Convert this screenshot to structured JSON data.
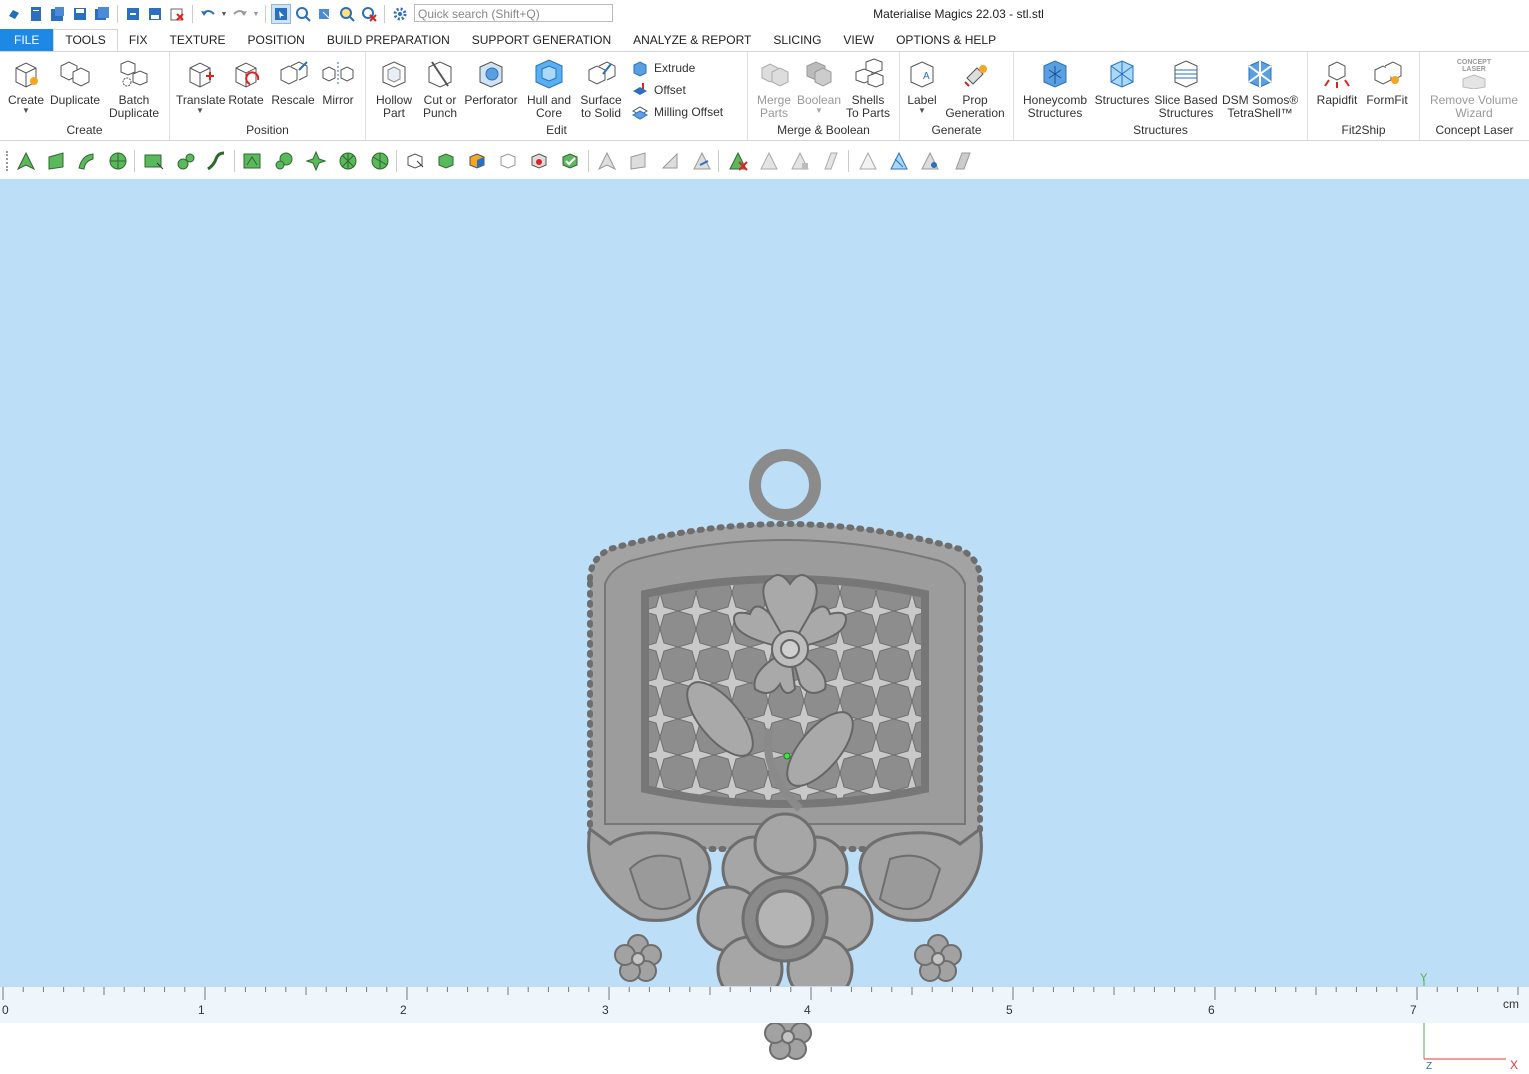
{
  "app": {
    "title": "Materialise Magics 22.03 - stl.stl",
    "search_placeholder": "Quick search (Shift+Q)"
  },
  "menu_tabs": [
    "FILE",
    "TOOLS",
    "FIX",
    "TEXTURE",
    "POSITION",
    "BUILD PREPARATION",
    "SUPPORT GENERATION",
    "ANALYZE & REPORT",
    "SLICING",
    "VIEW",
    "OPTIONS & HELP"
  ],
  "ribbon": {
    "create": {
      "label": "Create",
      "buttons": [
        "Create",
        "Duplicate",
        "Batch\nDuplicate"
      ]
    },
    "position": {
      "label": "Position",
      "buttons": [
        "Translate",
        "Rotate",
        "Rescale",
        "Mirror"
      ]
    },
    "edit": {
      "label": "Edit",
      "buttons": [
        "Hollow\nPart",
        "Cut or\nPunch",
        "Perforator",
        "Hull and\nCore",
        "Surface\nto Solid"
      ],
      "small": [
        "Extrude",
        "Offset",
        "Milling Offset"
      ]
    },
    "merge": {
      "label": "Merge & Boolean",
      "buttons": [
        "Merge\nParts",
        "Boolean",
        "Shells\nTo Parts"
      ]
    },
    "generate": {
      "label": "Generate",
      "buttons": [
        "Label",
        "Prop\nGeneration"
      ]
    },
    "structures": {
      "label": "Structures",
      "buttons": [
        "Honeycomb\nStructures",
        "Structures",
        "Slice Based\nStructures",
        "DSM Somos®\nTetraShell™"
      ]
    },
    "fit2ship": {
      "label": "Fit2Ship",
      "buttons": [
        "Rapidfit",
        "FormFit"
      ]
    },
    "concept": {
      "label": "Concept Laser",
      "buttons": [
        "Remove Volume\nWizard"
      ],
      "logo": "CONCEPT\nLASER"
    }
  },
  "ruler": {
    "ticks": [
      "0",
      "1",
      "2",
      "3",
      "4",
      "5",
      "6",
      "7"
    ],
    "unit": "cm"
  },
  "axis": {
    "y": "Y",
    "x": "X",
    "z": "Z"
  },
  "colors": {
    "accent": "#1e88e5",
    "viewport": "#bcdef7",
    "model": "#9a9a9a"
  }
}
